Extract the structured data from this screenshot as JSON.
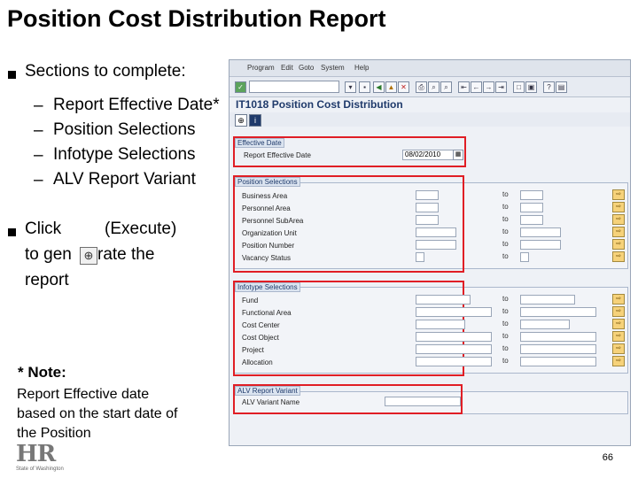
{
  "slide": {
    "title": "Position Cost Distribution Report",
    "sections_heading": "Sections to complete:",
    "sections": [
      "Report Effective Date*",
      "Position Selections",
      "Infotype Selections",
      "ALV Report Variant"
    ],
    "click_line1_a": "Click",
    "click_line1_b": "(Execute)",
    "click_line2_a": "to gen",
    "click_line2_b": "rate the",
    "click_line3": "report",
    "note_heading": "* Note:",
    "note_lines": [
      "Report Effective date",
      "based on the start date of",
      "the Position"
    ],
    "page_number": "66",
    "logo_text": "HR",
    "logo_subtext": "State of Washington"
  },
  "sap": {
    "menu": [
      "Program",
      "Edit",
      "Goto",
      "System",
      "Help"
    ],
    "screen_title": "IT1018 Position Cost Distribution",
    "effective_date_group": "Effective Date",
    "report_effective_date_label": "Report Effective Date",
    "report_effective_date_value": "08/02/2010",
    "position_group": "Position Selections",
    "position_fields": [
      "Business Area",
      "Personnel Area",
      "Personnel SubArea",
      "Organization Unit",
      "Position Number",
      "Vacancy Status"
    ],
    "infotype_group": "Infotype Selections",
    "infotype_fields": [
      "Fund",
      "Functional Area",
      "Cost Center",
      "Cost Object",
      "Project",
      "Allocation"
    ],
    "to_label": "to",
    "alv_group": "ALV Report Variant",
    "alv_field": "ALV Variant Name"
  },
  "colors": {
    "highlight": "#e01e25",
    "title_blue": "#1f3a6b"
  },
  "icons": [
    "execute-icon",
    "enter-icon",
    "save-icon",
    "back-icon",
    "exit-icon",
    "cancel-icon",
    "print-icon",
    "find-icon",
    "help-icon",
    "multiple-selection-icon"
  ]
}
